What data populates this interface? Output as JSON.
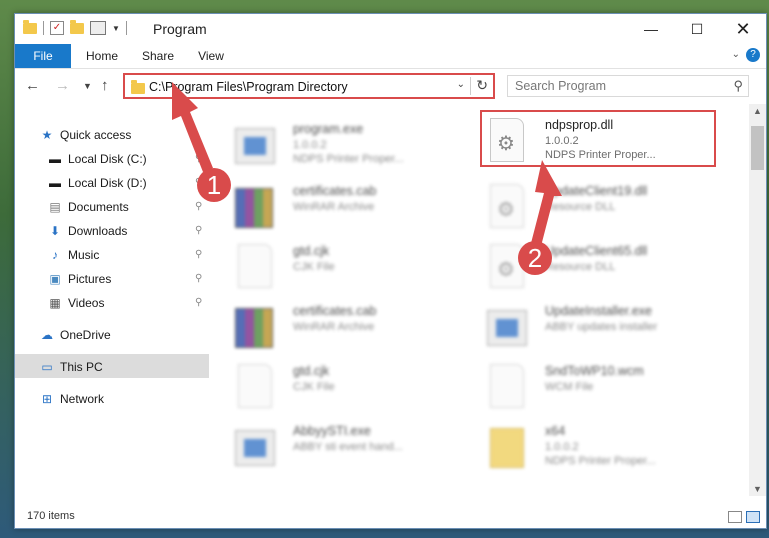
{
  "window": {
    "title": "Program"
  },
  "ribbon": {
    "tabs": [
      "File",
      "Home",
      "Share",
      "View"
    ]
  },
  "address": {
    "path": "C:\\Program Files\\Program Directory"
  },
  "search": {
    "placeholder": "Search Program"
  },
  "nav_pane": {
    "items": [
      {
        "label": "Quick access",
        "icon": "star-icon",
        "pinned": false
      },
      {
        "label": "Local Disk (C:)",
        "icon": "drive-icon",
        "pinned": true
      },
      {
        "label": "Local Disk (D:)",
        "icon": "drive-icon",
        "pinned": true
      },
      {
        "label": "Documents",
        "icon": "documents-icon",
        "pinned": true
      },
      {
        "label": "Downloads",
        "icon": "download-icon",
        "pinned": true
      },
      {
        "label": "Music",
        "icon": "music-icon",
        "pinned": true
      },
      {
        "label": "Pictures",
        "icon": "pictures-icon",
        "pinned": true
      },
      {
        "label": "Videos",
        "icon": "videos-icon",
        "pinned": true
      },
      {
        "label": "OneDrive",
        "icon": "cloud-icon",
        "pinned": false
      },
      {
        "label": "This PC",
        "icon": "computer-icon",
        "pinned": false,
        "selected": true
      },
      {
        "label": "Network",
        "icon": "network-icon",
        "pinned": false
      }
    ]
  },
  "files": [
    {
      "name": "program.exe",
      "line1": "1.0.0.2",
      "line2": "NDPS Printer Proper...",
      "icon": "exe-icon",
      "blurred": true
    },
    {
      "name": "ndpsprop.dll",
      "line1": "1.0.0.2",
      "line2": "NDPS Printer Proper...",
      "icon": "dll-icon",
      "blurred": false
    },
    {
      "name": "certificates.cab",
      "line1": "WinRAR Archive",
      "line2": "",
      "icon": "archive-icon",
      "blurred": true
    },
    {
      "name": "UpdateClient19.dll",
      "line1": "Resource DLL",
      "line2": "",
      "icon": "dll-icon",
      "blurred": true
    },
    {
      "name": "gtd.cjk",
      "line1": "CJK File",
      "line2": "",
      "icon": "file-icon",
      "blurred": true
    },
    {
      "name": "UpdateClient65.dll",
      "line1": "Resource DLL",
      "line2": "",
      "icon": "dll-icon",
      "blurred": true
    },
    {
      "name": "certificates.cab",
      "line1": "WinRAR Archive",
      "line2": "",
      "icon": "archive-icon",
      "blurred": true
    },
    {
      "name": "UpdateInstaller.exe",
      "line1": "ABBY updates installer",
      "line2": "",
      "icon": "exe-icon",
      "blurred": true
    },
    {
      "name": "gtd.cjk",
      "line1": "CJK File",
      "line2": "",
      "icon": "file-icon",
      "blurred": true
    },
    {
      "name": "SndToWP10.wcm",
      "line1": "WCM File",
      "line2": "",
      "icon": "file-icon",
      "blurred": true
    },
    {
      "name": "AbbyySTI.exe",
      "line1": "ABBY sti event hand...",
      "line2": "",
      "icon": "exe-icon",
      "blurred": true
    },
    {
      "name": "x64",
      "line1": "1.0.0.2",
      "line2": "NDPS Printer Proper...",
      "icon": "folder-icon",
      "blurred": true
    }
  ],
  "status": {
    "item_count": "170 items"
  },
  "callouts": {
    "one": "1",
    "two": "2"
  },
  "colors": {
    "accent": "#1979ca",
    "callout": "#d94b4b"
  }
}
